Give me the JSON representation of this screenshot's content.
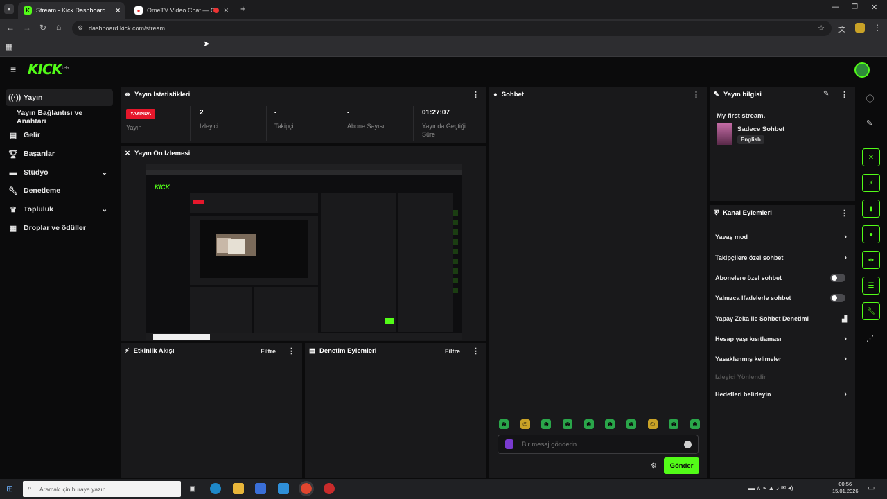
{
  "browser": {
    "tabs": [
      {
        "title": "Stream - Kick Dashboard",
        "active": true
      },
      {
        "title": "OmeTV Video Chat — Omegle",
        "active": false
      }
    ],
    "url": "dashboard.kick.com/stream",
    "new_tab": "+",
    "close": "✕"
  },
  "kick": {
    "logo": "KICK",
    "logo_sup": "beta"
  },
  "sidebar": {
    "items": [
      {
        "label": "Yayın",
        "icon": "broadcast-icon"
      },
      {
        "label": "Yayın Bağlantısı ve Anahtarı",
        "icon": ""
      },
      {
        "label": "Gelir",
        "icon": "revenue-icon"
      },
      {
        "label": "Başarılar",
        "icon": "trophy-icon"
      },
      {
        "label": "Stüdyo",
        "icon": "studio-icon"
      },
      {
        "label": "Denetleme",
        "icon": "wrench-icon"
      },
      {
        "label": "Topluluk",
        "icon": "community-icon"
      },
      {
        "label": "Droplar ve ödüller",
        "icon": "gift-icon"
      }
    ]
  },
  "stats": {
    "title": "Yayın İstatistikleri",
    "live_badge": "YAYINDA",
    "items": [
      {
        "value": "",
        "label": "Yayın"
      },
      {
        "value": "2",
        "label": "İzleyici"
      },
      {
        "value": "-",
        "label": "Takipçi"
      },
      {
        "value": "-",
        "label": "Abone Sayısı"
      },
      {
        "value": "01:27:07",
        "label": "Yayında Geçtiği Süre"
      }
    ]
  },
  "preview": {
    "title": "Yayın Ön İzlemesi"
  },
  "activity": {
    "title": "Etkinlik Akışı",
    "filter": "Filtre"
  },
  "moderation": {
    "title": "Denetim Eylemleri",
    "filter": "Filtre"
  },
  "chat": {
    "title": "Sohbet",
    "placeholder": "Bir mesaj gönderin",
    "send": "Gönder",
    "emotes": [
      "☻",
      "☺",
      "☻",
      "☻",
      "☻",
      "☻",
      "☻",
      "☺",
      "☻",
      "☻"
    ]
  },
  "streaminfo": {
    "title": "Yayın bilgisi",
    "stream_title": "My first stream.",
    "category": "Sadece Sohbet",
    "language": "English"
  },
  "channel_actions": {
    "title": "Kanal Eylemleri",
    "items": [
      {
        "label": "Yavaş mod",
        "kind": "chevron"
      },
      {
        "label": "Takipçilere özel sohbet",
        "kind": "chevron"
      },
      {
        "label": "Abonelere özel sohbet",
        "kind": "toggle"
      },
      {
        "label": "Yalnızca İfadelerle sohbet",
        "kind": "toggle"
      },
      {
        "label": "Yapay Zeka ile Sohbet Denetimi",
        "kind": "chart"
      },
      {
        "label": "Hesap yaşı kısıtlaması",
        "kind": "chevron"
      },
      {
        "label": "Yasaklanmış kelimeler",
        "kind": "chevron"
      },
      {
        "label": "İzleyici Yönlendir",
        "kind": "disabled"
      },
      {
        "label": "Hedefleri belirleyin",
        "kind": "chevron"
      }
    ]
  },
  "taskbar": {
    "search_placeholder": "Aramak için buraya yazın",
    "time": "00:56",
    "date": "15.01.2026"
  }
}
